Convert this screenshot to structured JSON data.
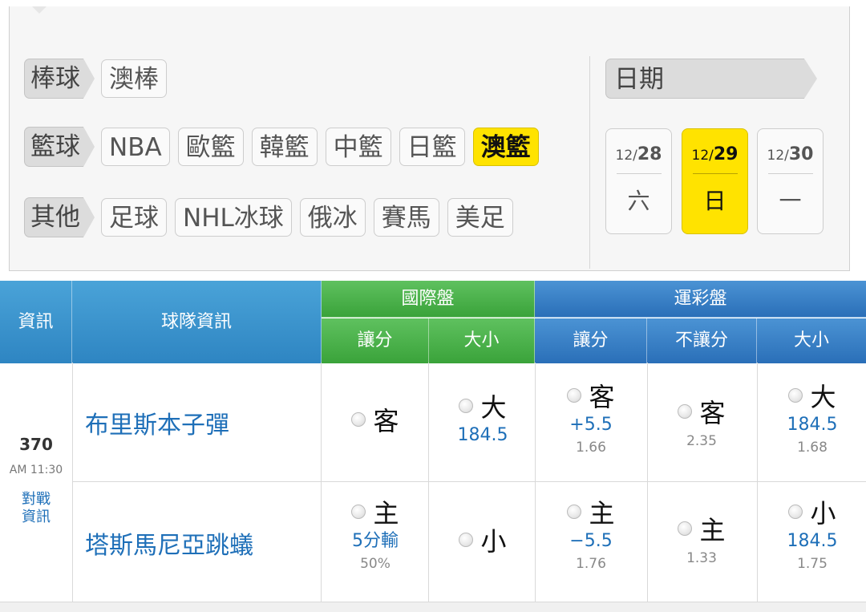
{
  "filters": {
    "rows": [
      {
        "category": "棒球",
        "items": [
          {
            "label": "澳棒",
            "active": false
          }
        ]
      },
      {
        "category": "籃球",
        "items": [
          {
            "label": "NBA",
            "active": false
          },
          {
            "label": "歐籃",
            "active": false
          },
          {
            "label": "韓籃",
            "active": false
          },
          {
            "label": "中籃",
            "active": false
          },
          {
            "label": "日籃",
            "active": false
          },
          {
            "label": "澳籃",
            "active": true
          }
        ]
      },
      {
        "category": "其他",
        "items": [
          {
            "label": "足球",
            "active": false
          },
          {
            "label": "NHL冰球",
            "active": false
          },
          {
            "label": "俄冰",
            "active": false
          },
          {
            "label": "賽馬",
            "active": false
          },
          {
            "label": "美足",
            "active": false
          }
        ]
      }
    ]
  },
  "date": {
    "label": "日期",
    "days": [
      {
        "month": "12/",
        "day": "28",
        "weekday": "六",
        "active": false
      },
      {
        "month": "12/",
        "day": "29",
        "weekday": "日",
        "active": true
      },
      {
        "month": "12/",
        "day": "30",
        "weekday": "一",
        "active": false
      }
    ]
  },
  "table": {
    "headers": {
      "info": "資訊",
      "team_info": "球隊資訊",
      "intl": "國際盤",
      "intl_spread": "讓分",
      "intl_total": "大小",
      "lottery": "運彩盤",
      "lot_spread": "讓分",
      "lot_moneyline": "不讓分",
      "lot_total": "大小"
    },
    "game": {
      "number": "370",
      "time": "AM 11:30",
      "matchup_link": "對戰資訊"
    },
    "away": {
      "team": "布里斯本子彈",
      "intl_spread": {
        "pick": "客",
        "line": "",
        "odds": ""
      },
      "intl_total": {
        "pick": "大",
        "line": "184.5",
        "odds": ""
      },
      "lot_spread": {
        "pick": "客",
        "line": "+5.5",
        "odds": "1.66"
      },
      "lot_moneyline": {
        "pick": "客",
        "line": "",
        "odds": "2.35"
      },
      "lot_total": {
        "pick": "大",
        "line": "184.5",
        "odds": "1.68"
      }
    },
    "home": {
      "team": "塔斯馬尼亞跳蟻",
      "intl_spread": {
        "pick": "主",
        "line": "5分輸",
        "odds": "50%"
      },
      "intl_total": {
        "pick": "小",
        "line": "",
        "odds": ""
      },
      "lot_spread": {
        "pick": "主",
        "line": "−5.5",
        "odds": "1.76"
      },
      "lot_moneyline": {
        "pick": "主",
        "line": "",
        "odds": "1.33"
      },
      "lot_total": {
        "pick": "小",
        "line": "184.5",
        "odds": "1.75"
      }
    }
  }
}
